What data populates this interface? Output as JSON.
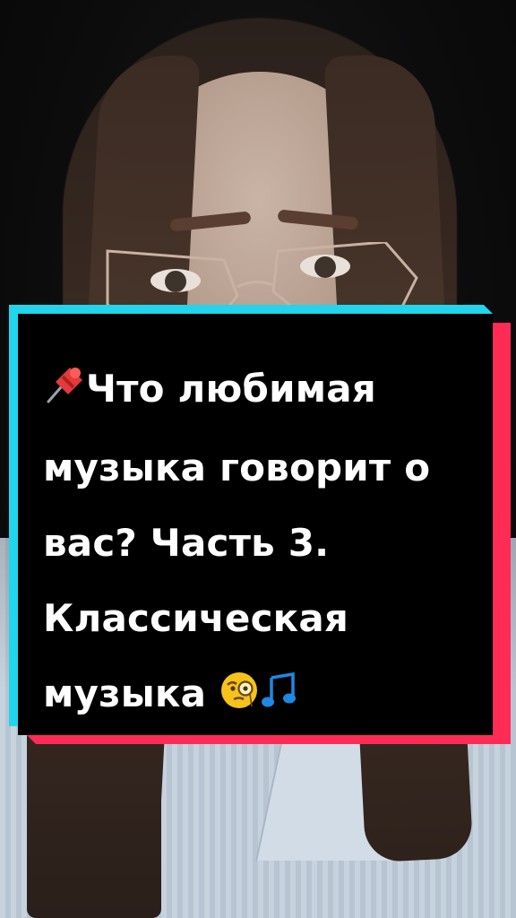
{
  "caption": {
    "lines": [
      "Что любимая",
      "музыка говорит о",
      "вас? Часть 3.",
      "Классическая",
      "музыка"
    ]
  },
  "icons": {
    "pin": "pushpin-icon",
    "monocle": "face-with-monocle-icon",
    "music": "music-notes-icon"
  },
  "colors": {
    "caption_bg": "#000000",
    "caption_text": "#ffffff",
    "accent_cyan": "#20d5ec",
    "accent_red": "#fe2c55"
  }
}
